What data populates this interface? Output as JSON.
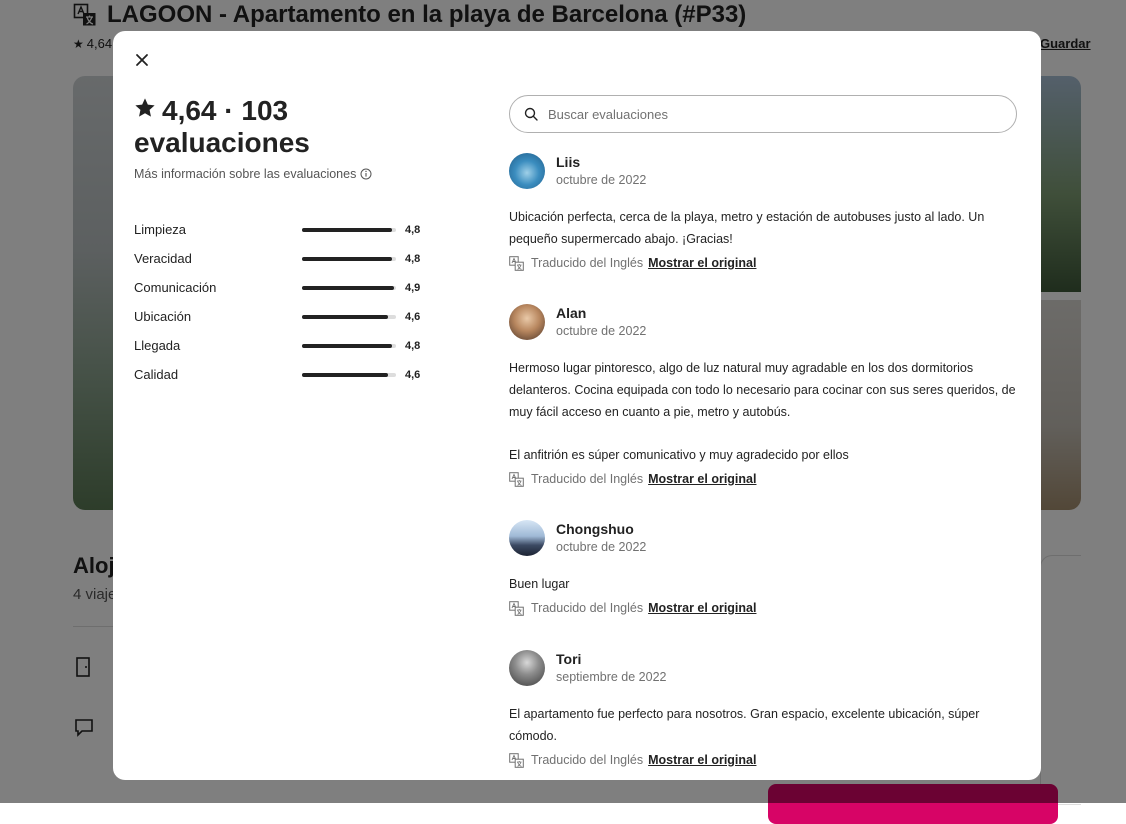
{
  "background": {
    "title": "LAGOON - Apartamento en la playa de Barcelona (#P33)",
    "rating_short": "4,64",
    "save_label": "Guardar",
    "section_heading": "Aloja",
    "guests_text": "4 viaje",
    "translate_icon": "translate-icon"
  },
  "modal": {
    "close_icon": "close-icon",
    "rating_value": "4,64",
    "rating_separator": "·",
    "review_count": "103",
    "reviews_word": "evaluaciones",
    "info_link": "Más información sobre las evaluaciones",
    "search_placeholder": "Buscar evaluaciones",
    "categories": [
      {
        "label": "Limpieza",
        "value": "4,8",
        "score": 4.8
      },
      {
        "label": "Veracidad",
        "value": "4,8",
        "score": 4.8
      },
      {
        "label": "Comunicación",
        "value": "4,9",
        "score": 4.9
      },
      {
        "label": "Ubicación",
        "value": "4,6",
        "score": 4.6
      },
      {
        "label": "Llegada",
        "value": "4,8",
        "score": 4.8
      },
      {
        "label": "Calidad",
        "value": "4,6",
        "score": 4.6
      }
    ],
    "reviews": [
      {
        "name": "Liis",
        "date": "octubre de 2022",
        "paragraphs": [
          "Ubicación perfecta, cerca de la playa, metro y estación de autobuses justo al lado. Un pequeño supermercado abajo. ¡Gracias!"
        ],
        "translated": "Traducido del Inglés",
        "show_original": "Mostrar el original"
      },
      {
        "name": "Alan",
        "date": "octubre de 2022",
        "paragraphs": [
          "Hermoso lugar pintoresco, algo de luz natural muy agradable en los dos dormitorios delanteros. Cocina equipada con todo lo necesario para cocinar con sus seres queridos, de muy fácil acceso en cuanto a pie, metro y autobús.",
          "El anfitrión es súper comunicativo y muy agradecido por ellos"
        ],
        "translated": "Traducido del Inglés",
        "show_original": "Mostrar el original"
      },
      {
        "name": "Chongshuo",
        "date": "octubre de 2022",
        "paragraphs": [
          "Buen lugar"
        ],
        "translated": "Traducido del Inglés",
        "show_original": "Mostrar el original"
      },
      {
        "name": "Tori",
        "date": "septiembre de 2022",
        "paragraphs": [
          "El apartamento fue perfecto para nosotros. Gran espacio, excelente ubicación, súper cómodo."
        ],
        "translated": "Traducido del Inglés",
        "show_original": "Mostrar el original"
      }
    ]
  }
}
